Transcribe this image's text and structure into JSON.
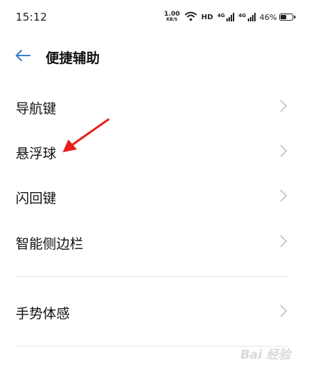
{
  "status_bar": {
    "time": "15:12",
    "speed_value": "1.00",
    "speed_unit": "KB/S",
    "hd_label": "HD",
    "signal1_label": "4G",
    "signal2_label": "4G",
    "battery_percent": "46%",
    "battery_level": 0.46,
    "icons": [
      "wifi-icon",
      "signal-icon",
      "battery-icon"
    ]
  },
  "header": {
    "back_icon": "back-arrow-icon",
    "title": "便捷辅助"
  },
  "menu": {
    "items": [
      {
        "label": "导航键"
      },
      {
        "label": "悬浮球"
      },
      {
        "label": "闪回键"
      },
      {
        "label": "智能侧边栏"
      },
      {
        "label": "手势体感"
      }
    ]
  },
  "watermark": "Bai 经验",
  "colors": {
    "accent": "#3a7bd5",
    "annotation_arrow": "#e8201a",
    "chevron": "#c4c4c4"
  }
}
